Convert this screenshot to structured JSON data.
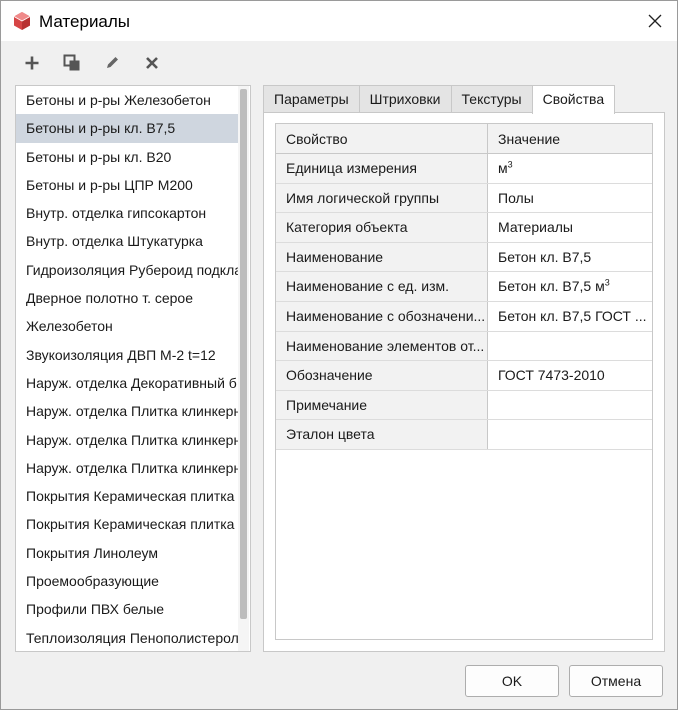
{
  "window": {
    "title": "Материалы"
  },
  "toolbar": {
    "buttons": [
      {
        "icon": "plus-icon"
      },
      {
        "icon": "copy-icon"
      },
      {
        "icon": "pencil-icon"
      },
      {
        "icon": "delete-icon"
      }
    ]
  },
  "materials": {
    "selected_index": 1,
    "items": [
      "Бетоны и р-ры Железобетон",
      "Бетоны и р-ры кл. В7,5",
      "Бетоны и р-ры кл. В20",
      "Бетоны и р-ры ЦПР М200",
      "Внутр. отделка гипсокартон",
      "Внутр. отделка Штукатурка",
      "Гидроизоляция Рубероид подкла",
      "Дверное полотно т. серое",
      "Железобетон",
      "Звукоизоляция ДВП М-2 t=12",
      "Наруж. отделка Декоративный б",
      "Наруж. отделка Плитка клинкерн",
      "Наруж. отделка Плитка клинкерн",
      "Наруж. отделка Плитка клинкерн",
      "Покрытия Керамическая плитка",
      "Покрытия Керамическая плитка",
      "Покрытия Линолеум",
      "Проемообразующие",
      "Профили ПВХ белые",
      "Теплоизоляция Пенополистерол"
    ]
  },
  "tabs": {
    "active": "Свойства",
    "items": [
      "Параметры",
      "Штриховки",
      "Текстуры",
      "Свойства"
    ]
  },
  "properties": {
    "header_property": "Свойство",
    "header_value": "Значение",
    "rows": [
      {
        "name": "Единица измерения",
        "value": "м",
        "sup": "3"
      },
      {
        "name": "Имя логической группы",
        "value": "Полы"
      },
      {
        "name": "Категория объекта",
        "value": "Материалы"
      },
      {
        "name": "Наименование",
        "value": "Бетон кл. В7,5"
      },
      {
        "name": "Наименование с ед. изм.",
        "value": "Бетон кл. В7,5 м",
        "sup": "3"
      },
      {
        "name": "Наименование с обозначени...",
        "value": "Бетон кл. В7,5 ГОСТ ..."
      },
      {
        "name": "Наименование элементов от...",
        "value": ""
      },
      {
        "name": "Обозначение",
        "value": "ГОСТ 7473-2010"
      },
      {
        "name": "Примечание",
        "value": ""
      },
      {
        "name": "Эталон цвета",
        "value": ""
      }
    ]
  },
  "buttons": {
    "ok": "OK",
    "cancel": "Отмена"
  },
  "colors": {
    "selection": "#cfd6df",
    "app_icon": "#d64545"
  }
}
